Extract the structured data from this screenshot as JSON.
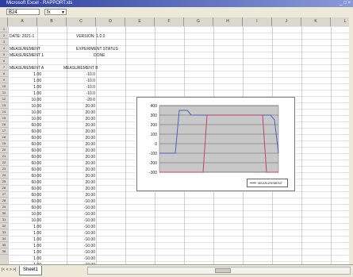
{
  "window": {
    "title": "Microsoft Excel - RAPPORT.xls",
    "controls": "_ □ ×"
  },
  "namebox": {
    "value": "B24"
  },
  "formula_icon": "fx",
  "columns": [
    "A",
    "B",
    "C",
    "D",
    "E",
    "F",
    "G",
    "H",
    "I",
    "J",
    "K",
    "L"
  ],
  "rows": [
    "1",
    "2",
    "3",
    "4",
    "5",
    "6",
    "7",
    "8",
    "9",
    "10",
    "11",
    "12",
    "13",
    "14",
    "15",
    "16",
    "17",
    "18",
    "19",
    "20",
    "21",
    "22",
    "23",
    "24",
    "25",
    "26",
    "27",
    "28",
    "29",
    "30",
    "31",
    "32",
    "33",
    "34",
    "35",
    "36"
  ],
  "sheet": {
    "header1": {
      "a": "DATE: 2021-1",
      "b": "VERSION: 1.0.0"
    },
    "header2": {
      "a": "MEASUREMENT",
      "b": "EXPERIMENT STATUS"
    },
    "header3": {
      "a": "MEASUREMENT 1",
      "b": "DONE"
    },
    "col_heads": {
      "a": "MEASUREMENT A",
      "b": "MEASUREMENT B"
    },
    "data_a": [
      "1.00",
      "1.00",
      "1.00",
      "1.00",
      "10.00",
      "10.00",
      "10.00",
      "10.00",
      "60.00",
      "60.00",
      "60.00",
      "60.00",
      "60.00",
      "60.00",
      "60.00",
      "60.00",
      "60.00",
      "60.00",
      "60.00",
      "60.00",
      "60.00",
      "60.00",
      "10.00",
      "10.00",
      "1.00",
      "1.00",
      "1.00",
      "1.00",
      "1.00",
      "1.00",
      "1.00"
    ],
    "data_b": [
      "-10.0",
      "-10.0",
      "-10.0",
      "-10.0",
      "-20.0",
      "20.00",
      "20.00",
      "20.00",
      "20.00",
      "20.00",
      "20.00",
      "20.00",
      "20.00",
      "20.00",
      "20.00",
      "20.00",
      "20.00",
      "20.00",
      "20.00",
      "20.00",
      "-10.00",
      "-10.00",
      "-10.00",
      "-10.00",
      "-10.00",
      "-10.00",
      "-10.00",
      "-10.00",
      "-10.00",
      "-10.00",
      "-10.00"
    ]
  },
  "chart_data": {
    "type": "line",
    "y_ticks": [
      "400",
      "300",
      "200",
      "100",
      "0",
      "-100",
      "-200",
      "-300"
    ],
    "ylim": [
      -300,
      400
    ],
    "series": [
      {
        "color": "#5060c0",
        "values": [
          -100,
          -100,
          -100,
          -100,
          -100,
          350,
          350,
          350,
          300,
          300,
          300,
          300,
          300,
          300,
          300,
          300,
          300,
          300,
          300,
          300,
          300,
          300,
          300,
          300,
          300,
          300,
          300,
          300,
          300,
          250,
          -100
        ]
      },
      {
        "color": "#c04070",
        "values": [
          -300,
          -300,
          -300,
          -300,
          -300,
          -300,
          -300,
          -300,
          -300,
          -300,
          -300,
          -300,
          300,
          300,
          300,
          300,
          300,
          300,
          300,
          300,
          300,
          300,
          300,
          300,
          300,
          300,
          300,
          -300,
          -300,
          -300,
          -300
        ]
      }
    ],
    "legend": {
      "label": "MEASUREMENT",
      "position": "bottom-right"
    }
  },
  "sheet_tab": {
    "label": "Sheet1"
  },
  "nav_arrows": "|< < > >|"
}
